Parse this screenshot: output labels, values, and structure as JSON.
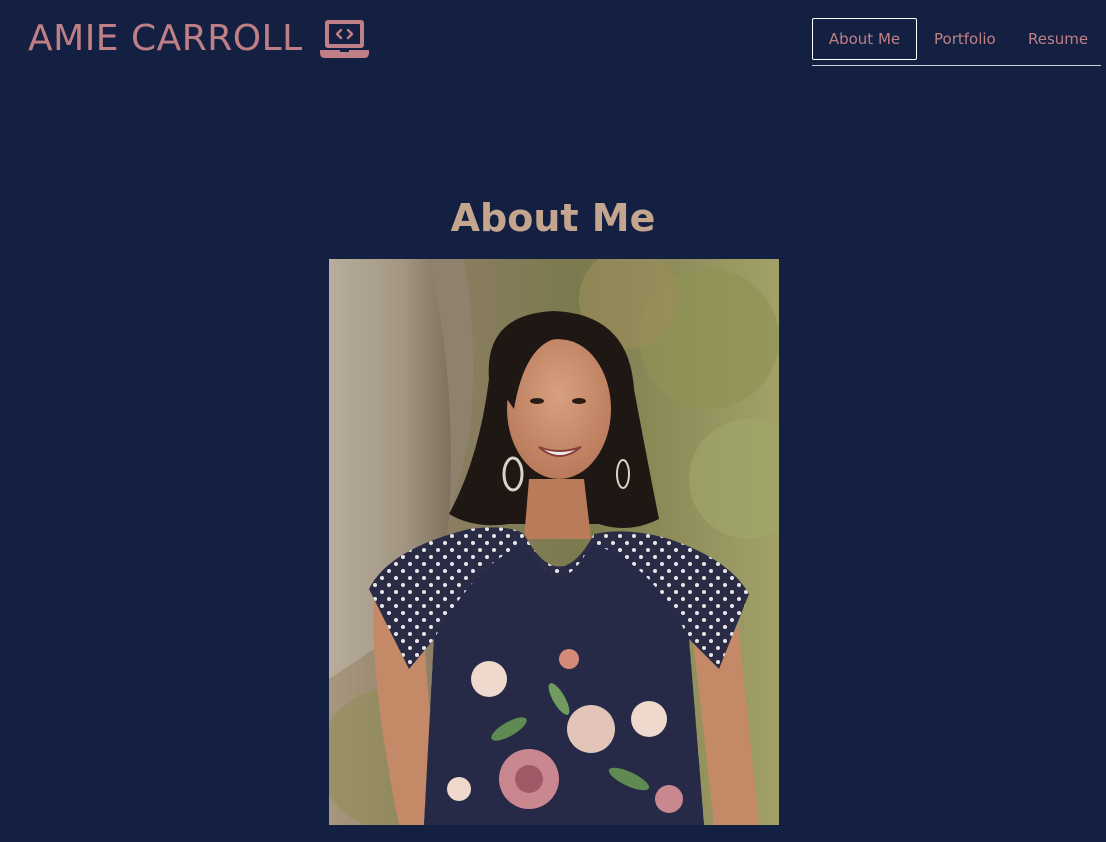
{
  "header": {
    "brand_name": "AMIE CARROLL",
    "brand_icon": "laptop-code-icon"
  },
  "nav": {
    "items": [
      {
        "label": "About Me",
        "active": true
      },
      {
        "label": "Portfolio",
        "active": false
      },
      {
        "label": "Resume",
        "active": false
      }
    ]
  },
  "main": {
    "section_title": "About Me",
    "photo": "portrait-photo"
  },
  "colors": {
    "background": "#132042",
    "brand": "#c07f86",
    "title": "#c4a58e",
    "nav_border": "#ffffff"
  }
}
